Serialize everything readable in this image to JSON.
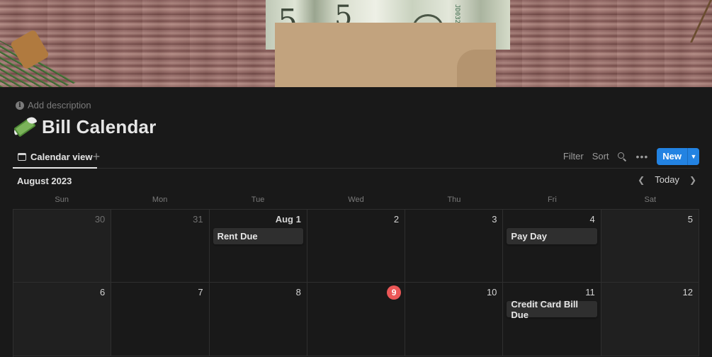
{
  "page": {
    "add_description": "Add description",
    "title": "Bill Calendar",
    "icon": "money-with-wings-icon"
  },
  "view": {
    "tab_label": "Calendar view",
    "add_view_glyph": "+",
    "filter": "Filter",
    "sort": "Sort",
    "more_glyph": "•••",
    "new_label": "New"
  },
  "calendar": {
    "month": "August 2023",
    "today_label": "Today",
    "weekdays": [
      "Sun",
      "Mon",
      "Tue",
      "Wed",
      "Thu",
      "Fri",
      "Sat"
    ],
    "weeks": [
      [
        {
          "day": "30",
          "other": true
        },
        {
          "day": "31",
          "other": true
        },
        {
          "day": "Aug 1",
          "event": "Rent Due"
        },
        {
          "day": "2"
        },
        {
          "day": "3"
        },
        {
          "day": "4",
          "event": "Pay Day"
        },
        {
          "day": "5"
        }
      ],
      [
        {
          "day": "6"
        },
        {
          "day": "7"
        },
        {
          "day": "8"
        },
        {
          "day": "9",
          "today": true
        },
        {
          "day": "10"
        },
        {
          "day": "11",
          "event": "Credit Card Bill Due"
        },
        {
          "day": "12"
        }
      ]
    ]
  },
  "colors": {
    "background": "#191919",
    "accent": "#2383e2",
    "today": "#eb5757"
  }
}
